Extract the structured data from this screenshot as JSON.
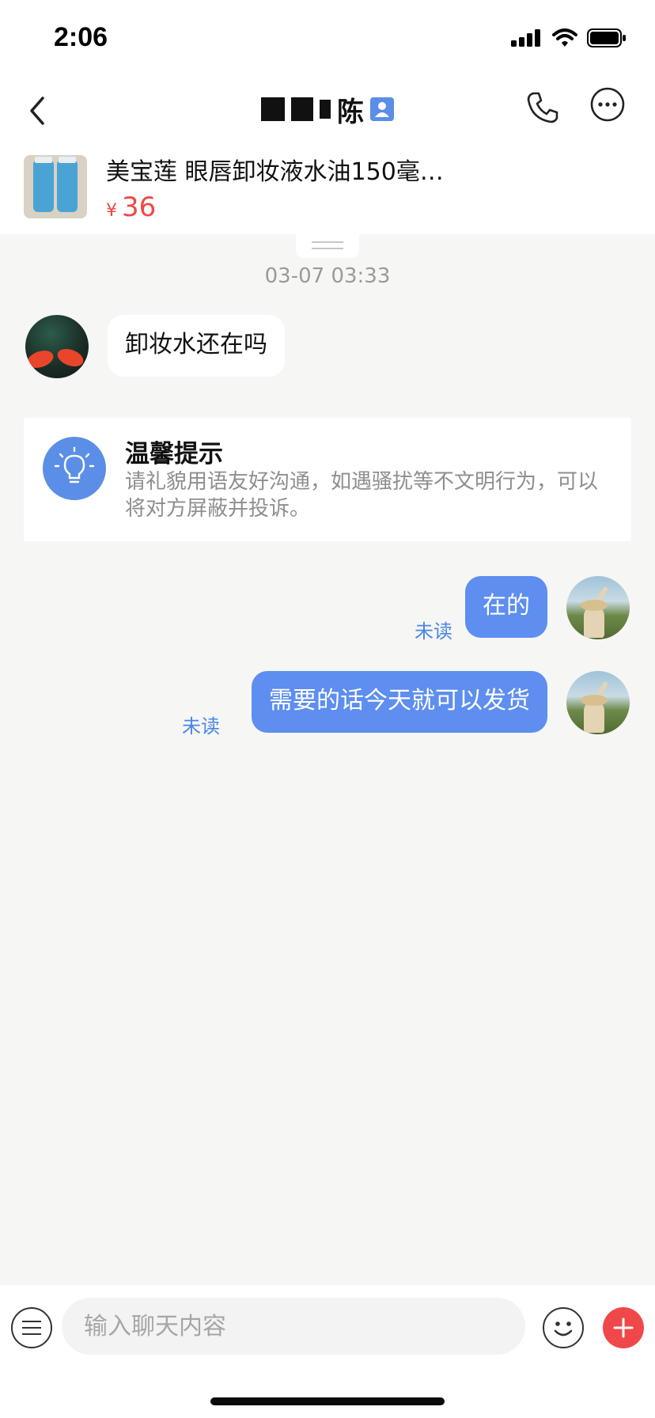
{
  "status_bar": {
    "time": "2:06",
    "icons": [
      "signal-icon",
      "wifi-icon",
      "battery-icon"
    ]
  },
  "header": {
    "title_visible": "陈",
    "icons": [
      "back-icon",
      "verified-user-icon",
      "phone-icon",
      "more-icon"
    ]
  },
  "product": {
    "name": "美宝莲 眼唇卸妆液水油150毫…",
    "currency": "¥",
    "price": "36"
  },
  "chat": {
    "timestamp": "03-07 03:33",
    "messages": [
      {
        "direction": "incoming",
        "text": "卸妆水还在吗"
      },
      {
        "direction": "outgoing",
        "text": "在的",
        "status": "未读"
      },
      {
        "direction": "outgoing",
        "text": "需要的话今天就可以发货",
        "status": "未读"
      }
    ],
    "tip": {
      "title": "温馨提示",
      "text": "请礼貌用语友好沟通，如遇骚扰等不文明行为，可以将对方屏蔽并投诉。"
    }
  },
  "input_bar": {
    "placeholder": "输入聊天内容",
    "icons": [
      "menu-icon",
      "emoji-icon",
      "plus-icon"
    ]
  },
  "colors": {
    "accent_blue": "#5d8ef0",
    "price_red": "#f04848",
    "plus_red": "#f0474a",
    "background": "#f6f6f4"
  }
}
